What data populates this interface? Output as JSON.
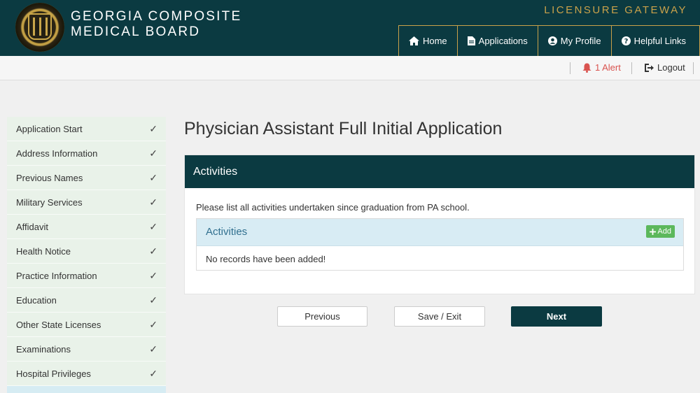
{
  "header": {
    "brand_line1": "GEORGIA COMPOSITE",
    "brand_line2": "MEDICAL BOARD",
    "gateway": "LICENSURE GATEWAY",
    "nav": [
      {
        "label": "Home",
        "icon": "home-icon"
      },
      {
        "label": "Applications",
        "icon": "document-icon"
      },
      {
        "label": "My Profile",
        "icon": "user-circle-icon"
      },
      {
        "label": "Helpful Links",
        "icon": "question-circle-icon"
      }
    ]
  },
  "subbar": {
    "alert_label": "1 Alert",
    "logout_label": "Logout"
  },
  "sidebar": {
    "items": [
      {
        "label": "Application Start",
        "status": "✓"
      },
      {
        "label": "Address Information",
        "status": "✓"
      },
      {
        "label": "Previous Names",
        "status": "✓"
      },
      {
        "label": "Military Services",
        "status": "✓"
      },
      {
        "label": "Affidavit",
        "status": "✓"
      },
      {
        "label": "Health Notice",
        "status": "✓"
      },
      {
        "label": "Practice Information",
        "status": "✓"
      },
      {
        "label": "Education",
        "status": "✓"
      },
      {
        "label": "Other State Licenses",
        "status": "✓"
      },
      {
        "label": "Examinations",
        "status": "✓"
      },
      {
        "label": "Hospital Privileges",
        "status": "✓"
      }
    ]
  },
  "main": {
    "page_title": "Physician Assistant Full Initial Application",
    "panel_title": "Activities",
    "description": "Please list all activities undertaken since graduation from PA school.",
    "inner_title": "Activities",
    "add_label": "Add",
    "empty_message": "No records have been added!"
  },
  "buttons": {
    "previous": "Previous",
    "save_exit": "Save / Exit",
    "next": "Next"
  },
  "colors": {
    "primary": "#0b3a41",
    "gold": "#c9a14a",
    "sidebar_bg": "#e9f2e9",
    "add_green": "#5cb85c",
    "alert_red": "#d9534f"
  }
}
